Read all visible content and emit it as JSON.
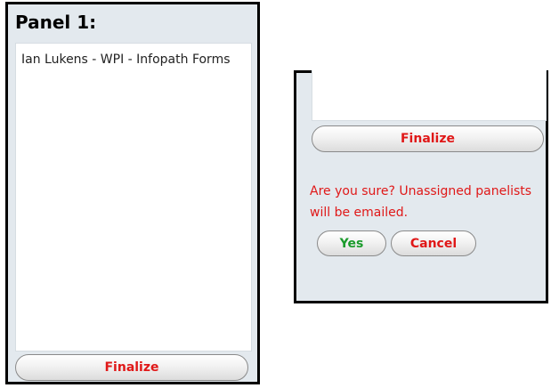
{
  "left_panel": {
    "title": "Panel 1:",
    "text_content": "Ian Lukens - WPI - Infopath Forms",
    "finalize_label": "Finalize"
  },
  "right_panel": {
    "finalize_label": "Finalize",
    "confirm_message": "Are you sure? Unassigned panelists will be emailed.",
    "yes_label": "Yes",
    "cancel_label": "Cancel"
  },
  "colors": {
    "panel_background": "#e3e9ee",
    "warning_text": "#e01818",
    "confirm_text": "#1b9b2c"
  }
}
